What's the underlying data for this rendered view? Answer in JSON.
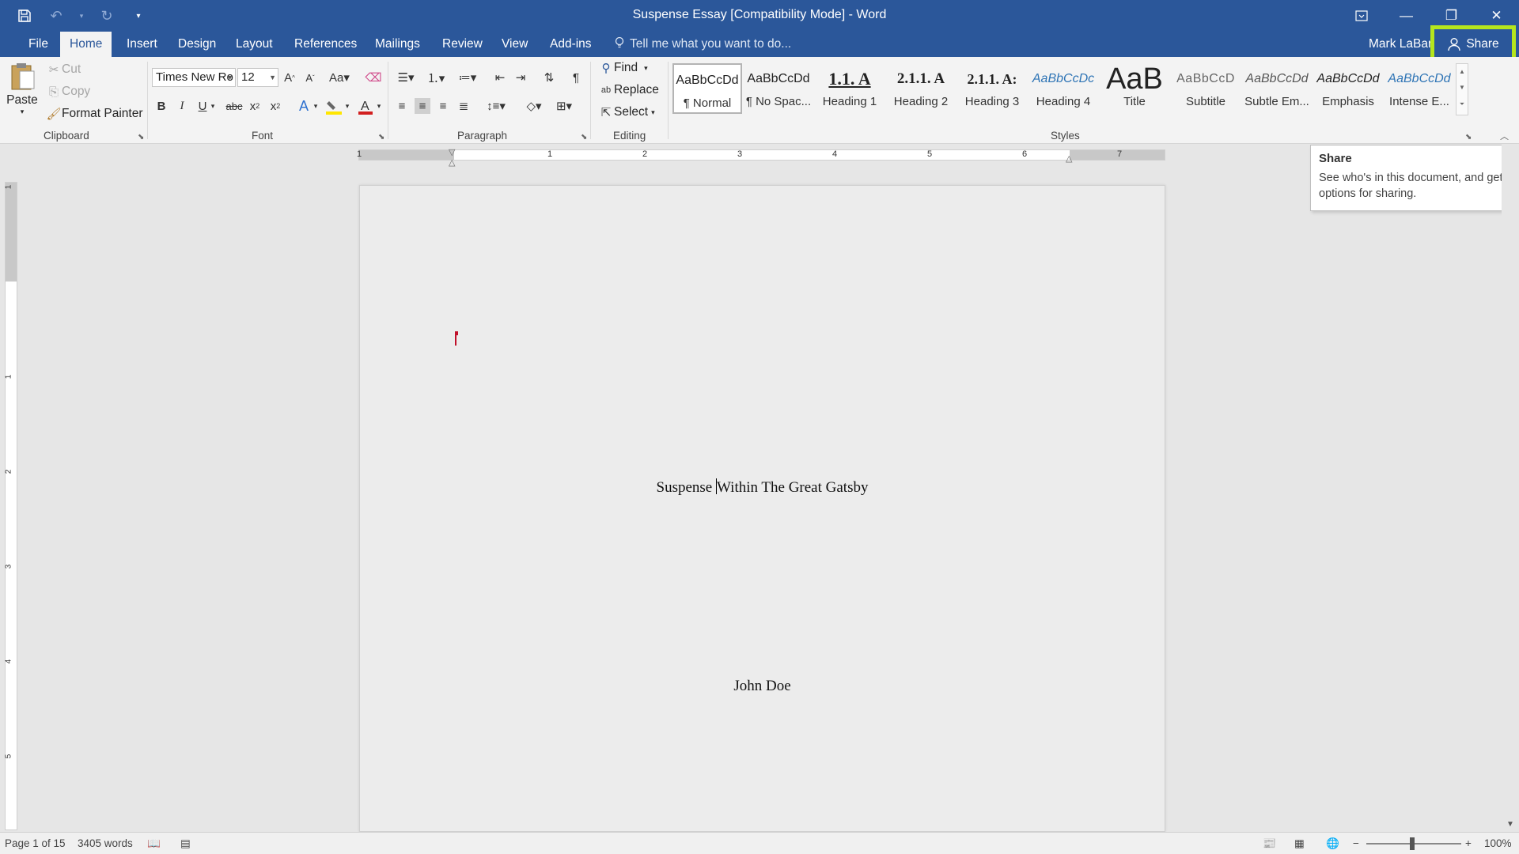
{
  "titlebar": {
    "document_title": "Suspense Essay [Compatibility Mode] - Word",
    "qat": {
      "save_icon": "save-icon",
      "undo_icon": "undo-icon",
      "redo_icon": "redo-icon",
      "customize_icon": "customize-qat-icon"
    },
    "window_controls": [
      "ribbon-display-options",
      "minimize",
      "restore",
      "close"
    ]
  },
  "tabs": {
    "file": "File",
    "home": "Home",
    "insert": "Insert",
    "design": "Design",
    "layout": "Layout",
    "references": "References",
    "mailings": "Mailings",
    "review": "Review",
    "view": "View",
    "addins": "Add-ins",
    "active": "Home"
  },
  "tellme": {
    "placeholder": "Tell me what you want to do..."
  },
  "user": {
    "name": "Mark LaBar"
  },
  "share": {
    "label": "Share",
    "highlight_color": "#b5e61d"
  },
  "ribbon": {
    "clipboard": {
      "label": "Clipboard",
      "paste": "Paste",
      "cut": "Cut",
      "copy": "Copy",
      "format_painter": "Format Painter"
    },
    "font": {
      "label": "Font",
      "font_name": "Times New Ro",
      "font_size": "12"
    },
    "paragraph": {
      "label": "Paragraph"
    },
    "editing": {
      "label": "Editing",
      "find": "Find",
      "replace": "Replace",
      "select": "Select"
    },
    "styles": {
      "label": "Styles",
      "items": [
        {
          "sample": "AaBbCcDd",
          "name": "¶ Normal"
        },
        {
          "sample": "AaBbCcDd",
          "name": "¶ No Spac..."
        },
        {
          "sample": "1.1.  A",
          "name": "Heading 1"
        },
        {
          "sample": "2.1.1.  A",
          "name": "Heading 2"
        },
        {
          "sample": "2.1.1.  A:",
          "name": "Heading 3"
        },
        {
          "sample": "AaBbCcDc",
          "name": "Heading 4"
        },
        {
          "sample": "AaB",
          "name": "Title"
        },
        {
          "sample": "AaBbCcD",
          "name": "Subtitle"
        },
        {
          "sample": "AaBbCcDd",
          "name": "Subtle Em..."
        },
        {
          "sample": "AaBbCcDd",
          "name": "Emphasis"
        },
        {
          "sample": "AaBbCcDd",
          "name": "Intense E..."
        }
      ]
    }
  },
  "ruler": {
    "tab_selector": "L",
    "numbers": [
      "1",
      "1",
      "2",
      "3",
      "4",
      "5",
      "6",
      "7"
    ],
    "vertical_numbers": [
      "1",
      "1",
      "2",
      "3",
      "4",
      "5"
    ]
  },
  "document": {
    "title_line_before": "Suspense ",
    "title_line_after": "Within The Great Gatsby",
    "author": "John Doe"
  },
  "tooltip": {
    "title": "Share",
    "body": "See who's in this document, and get options for sharing."
  },
  "status": {
    "page": "Page 1 of 15",
    "words": "3405 words",
    "zoom": "100%"
  },
  "colors": {
    "titlebar": "#2b579a",
    "active_tab_text": "#2b579a",
    "font_color": "#d21f1f",
    "highlight": "#ffe600"
  }
}
